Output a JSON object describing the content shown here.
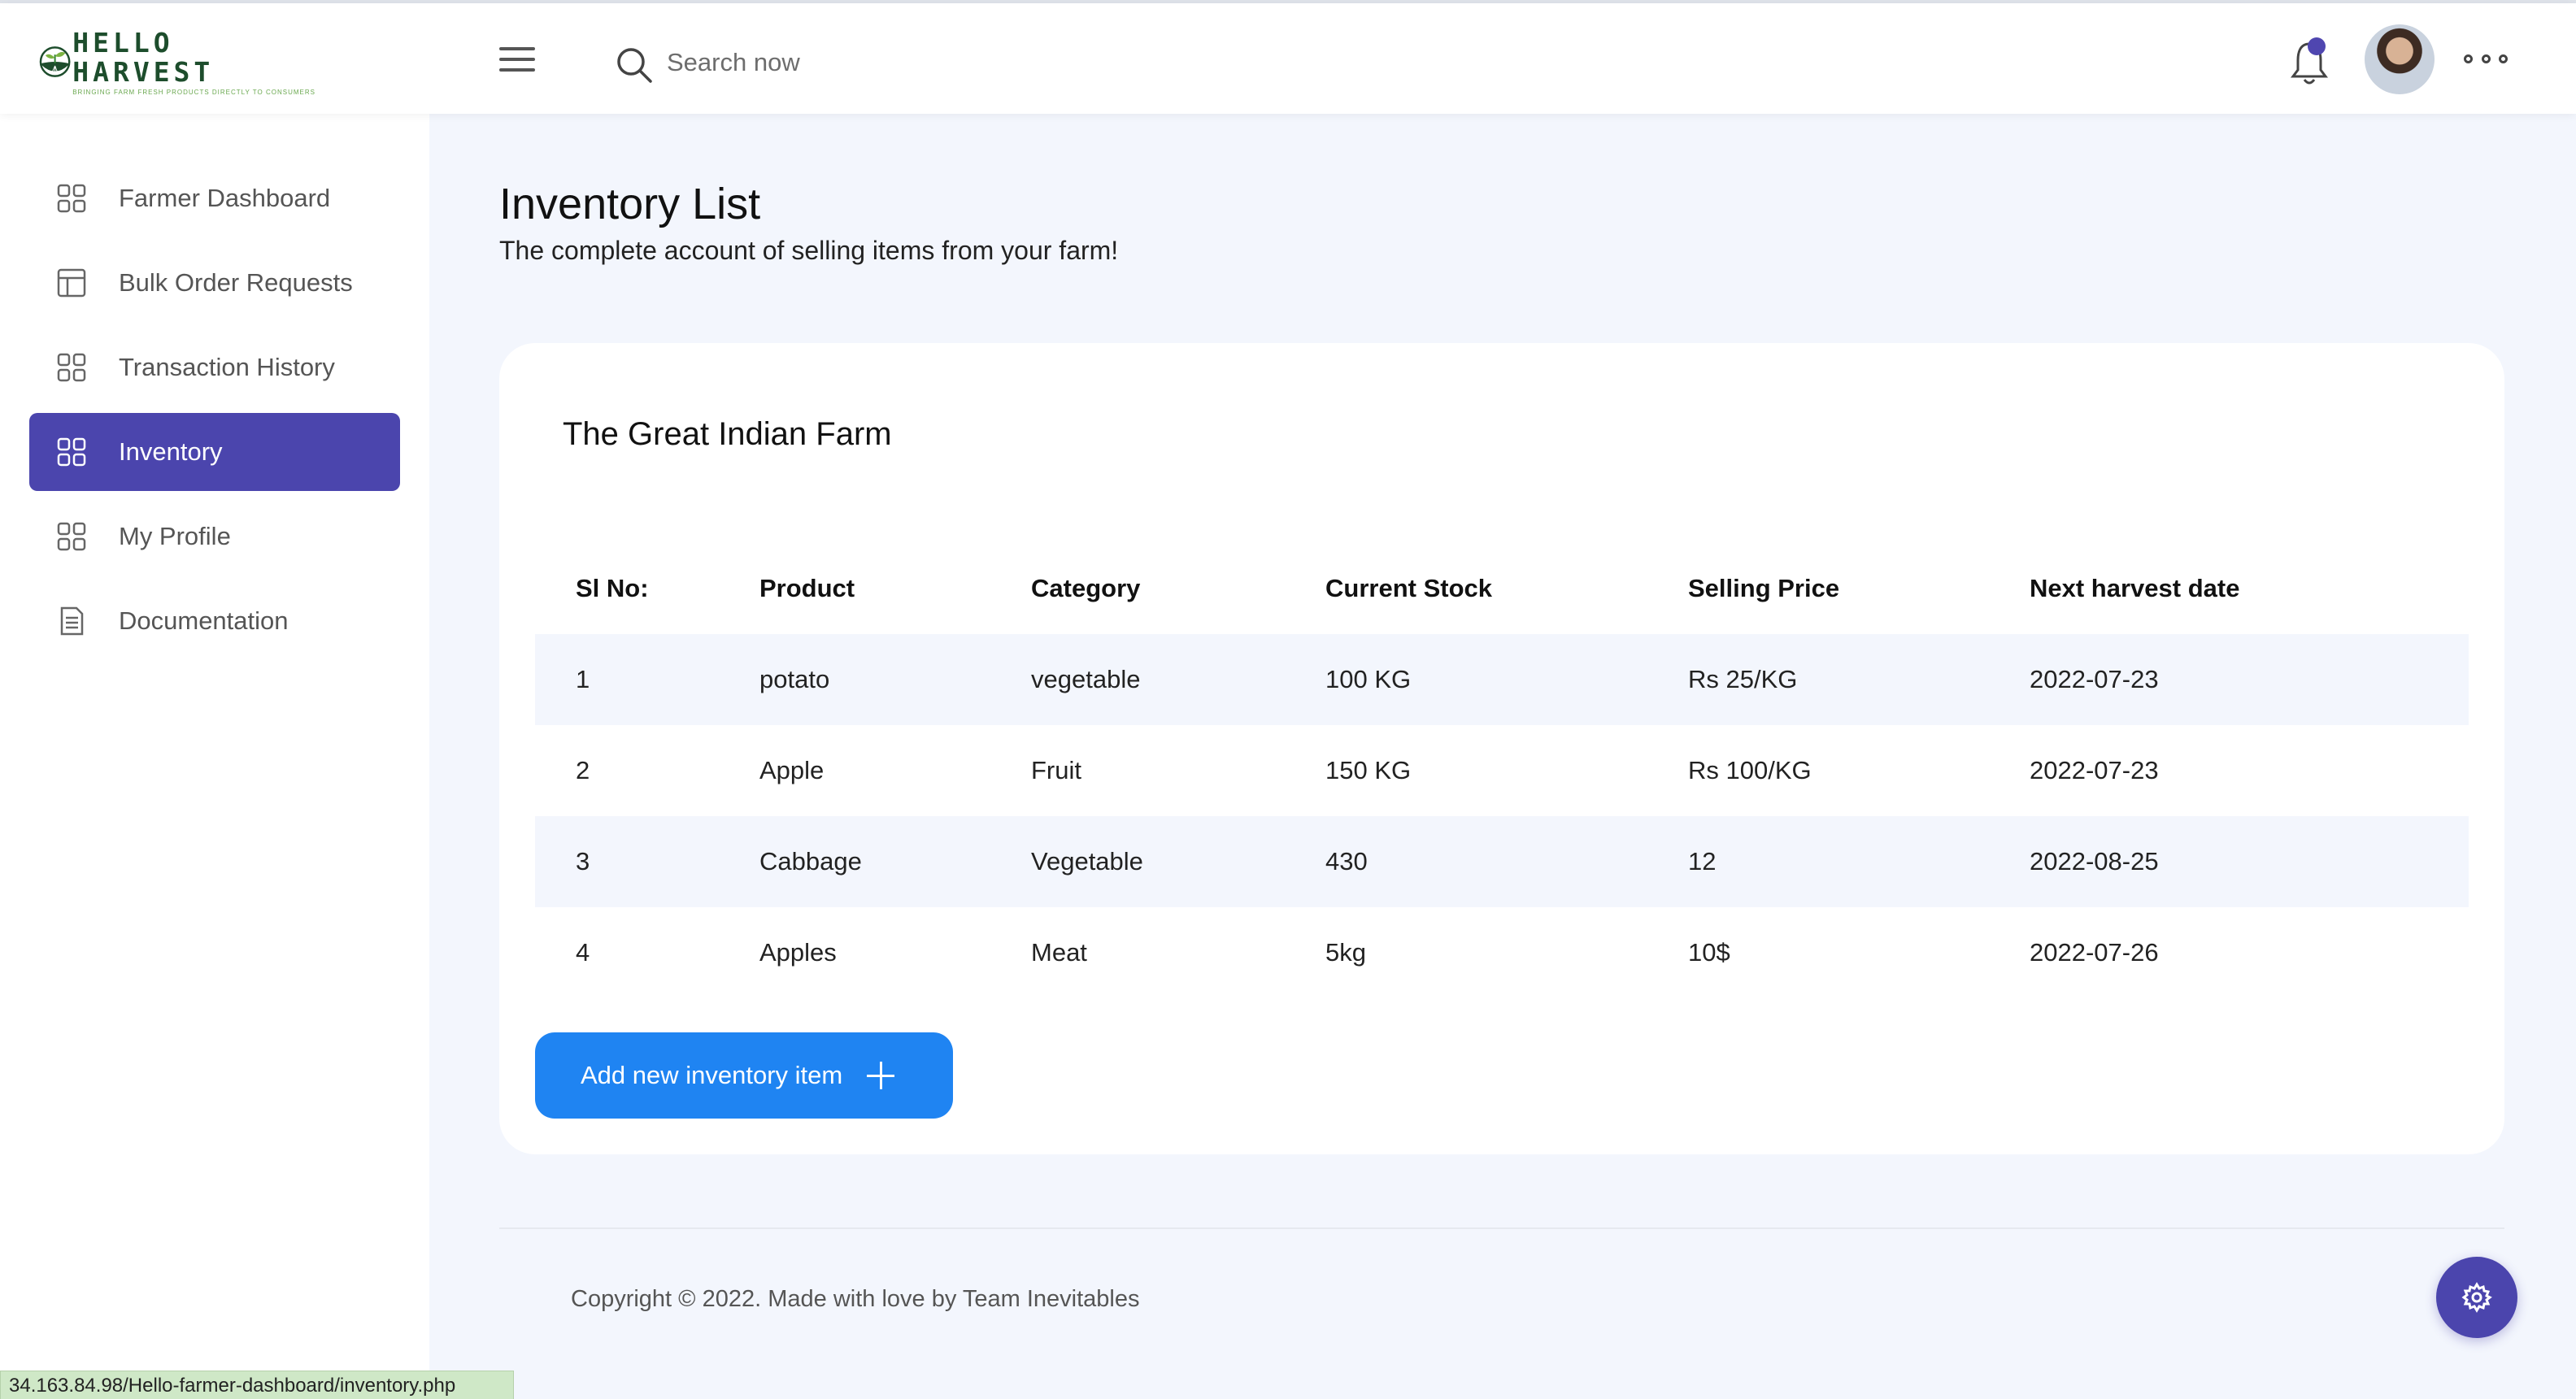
{
  "brand": {
    "name": "HELLO HARVEST",
    "tagline": "BRINGING FARM FRESH PRODUCTS DIRECTLY TO CONSUMERS"
  },
  "header": {
    "search_placeholder": "Search now",
    "notification_icon": "bell-icon",
    "menu_icon": "hamburger-icon",
    "more_icon": "more-horizontal-icon"
  },
  "sidebar": {
    "items": [
      {
        "label": "Farmer Dashboard",
        "icon": "grid-icon"
      },
      {
        "label": "Bulk Order Requests",
        "icon": "layout-icon"
      },
      {
        "label": "Transaction History",
        "icon": "grid-icon"
      },
      {
        "label": "Inventory",
        "icon": "grid-icon",
        "active": true
      },
      {
        "label": "My Profile",
        "icon": "grid-icon"
      },
      {
        "label": "Documentation",
        "icon": "document-icon"
      }
    ]
  },
  "main": {
    "title": "Inventory List",
    "subtitle": "The complete account of selling items from your farm!",
    "farm_name": "The Great Indian Farm",
    "table": {
      "headers": [
        "Sl No:",
        "Product",
        "Category",
        "Current Stock",
        "Selling Price",
        "Next harvest date"
      ],
      "rows": [
        [
          "1",
          "potato",
          "vegetable",
          "100 KG",
          "Rs 25/KG",
          "2022-07-23"
        ],
        [
          "2",
          "Apple",
          "Fruit",
          "150 KG",
          "Rs 100/KG",
          "2022-07-23"
        ],
        [
          "3",
          "Cabbage",
          "Vegetable",
          "430",
          "12",
          "2022-08-25"
        ],
        [
          "4",
          "Apples",
          "Meat",
          "5kg",
          "10$",
          "2022-07-26"
        ]
      ]
    },
    "add_button_label": "Add new inventory item"
  },
  "footer": {
    "copyright": "Copyright © 2022. Made with love by Team Inevitables"
  },
  "status_bar": {
    "url": "34.163.84.98/Hello-farmer-dashboard/inventory.php"
  },
  "colors": {
    "accent": "#4b45ad",
    "button_blue": "#1f84f2",
    "background": "#f3f6fd"
  }
}
